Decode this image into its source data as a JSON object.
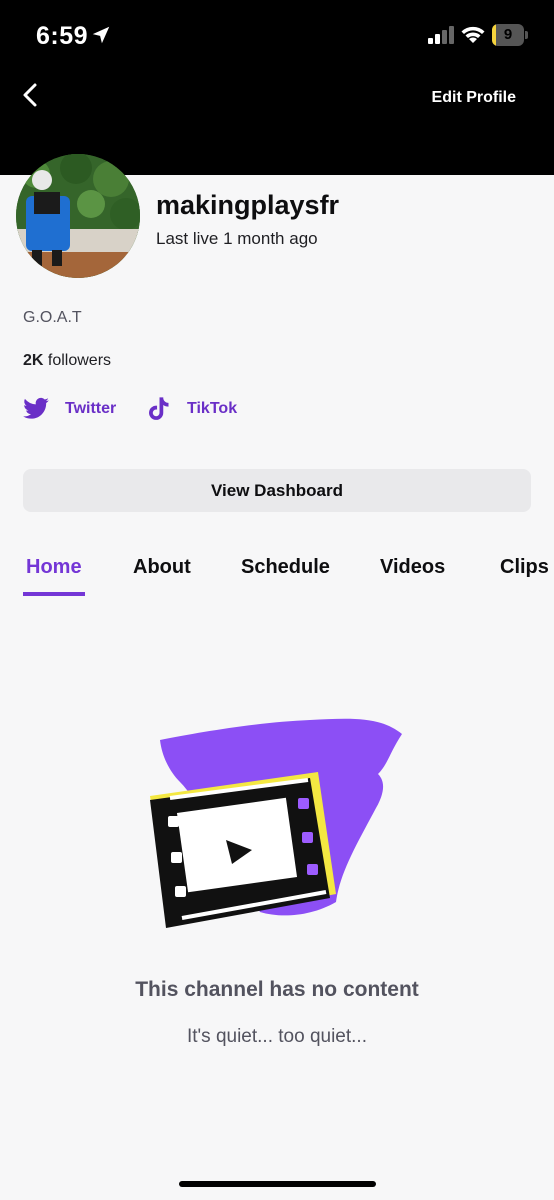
{
  "status_bar": {
    "time": "6:59",
    "battery_level": "9",
    "battery_fraction": 0.09
  },
  "header": {
    "back_icon": "chevron-left-icon",
    "edit_profile_label": "Edit Profile"
  },
  "profile": {
    "username": "makingplaysfr",
    "last_live": "Last live 1 month ago",
    "bio": "G.O.A.T",
    "followers_count": "2K",
    "followers_label": " followers",
    "socials": [
      {
        "label": "Twitter",
        "icon": "twitter-bird-icon"
      },
      {
        "label": "TikTok",
        "icon": "tiktok-icon"
      }
    ],
    "dashboard_button": "View Dashboard"
  },
  "tabs": [
    {
      "label": "Home",
      "active": true
    },
    {
      "label": "About"
    },
    {
      "label": "Schedule"
    },
    {
      "label": "Videos"
    },
    {
      "label": "Clips"
    }
  ],
  "empty_state": {
    "title": "This channel has no content",
    "subtitle": "It's quiet... too quiet...",
    "icon": "film-strip-play-icon"
  },
  "colors": {
    "accent": "#7436d6",
    "link": "#6a2fc7",
    "header_bg": "#000000",
    "page_bg": "#f7f7f8"
  }
}
